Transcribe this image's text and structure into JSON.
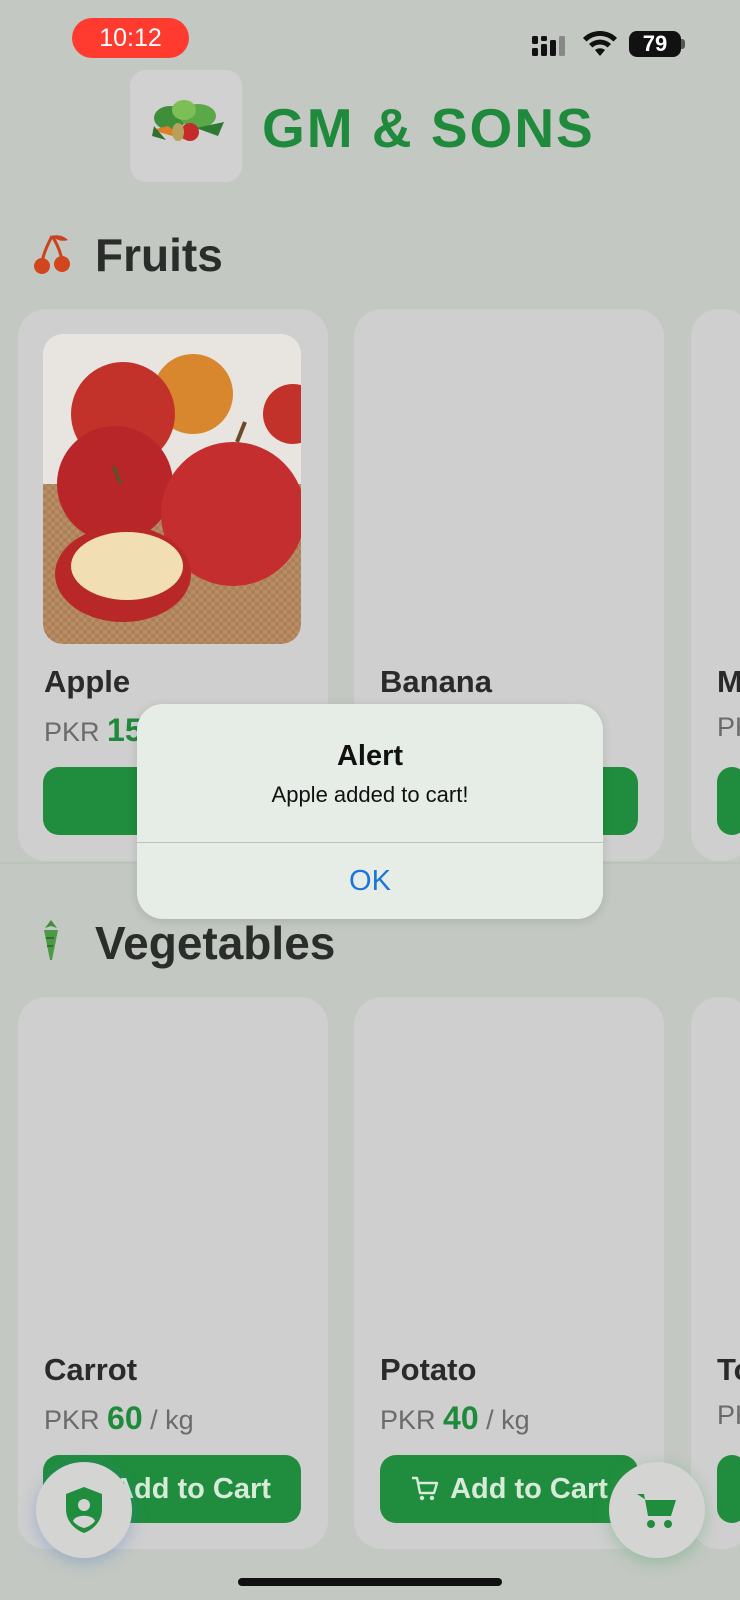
{
  "status_bar": {
    "time": "10:12",
    "battery": "79"
  },
  "header": {
    "brand": "GM & SONS",
    "logo_icon": "vegetable-basket-logo"
  },
  "sections": {
    "fruits": {
      "title": "Fruits",
      "icon": "cherry-icon",
      "products": [
        {
          "name": "Apple",
          "currency": "PKR",
          "price": "15"
        },
        {
          "name": "Banana"
        },
        {
          "name": "M",
          "currency": "PK"
        }
      ]
    },
    "vegetables": {
      "title": "Vegetables",
      "icon": "carrot-icon",
      "products": [
        {
          "name": "Carrot",
          "currency": "PKR",
          "price": "60",
          "unit": "/ kg"
        },
        {
          "name": "Potato",
          "currency": "PKR",
          "price": "40",
          "unit": "/ kg"
        },
        {
          "name": "To",
          "currency": "PK"
        }
      ]
    }
  },
  "buttons": {
    "add_to_cart": "Add to Cart",
    "add_partial": "A"
  },
  "alert": {
    "title": "Alert",
    "message": "Apple added to cart!",
    "ok": "OK"
  },
  "colors": {
    "brand_green": "#1f8a3c",
    "button_green": "#1f8d3d",
    "alert_blue": "#1d75d8",
    "status_red": "#ff3b30"
  }
}
